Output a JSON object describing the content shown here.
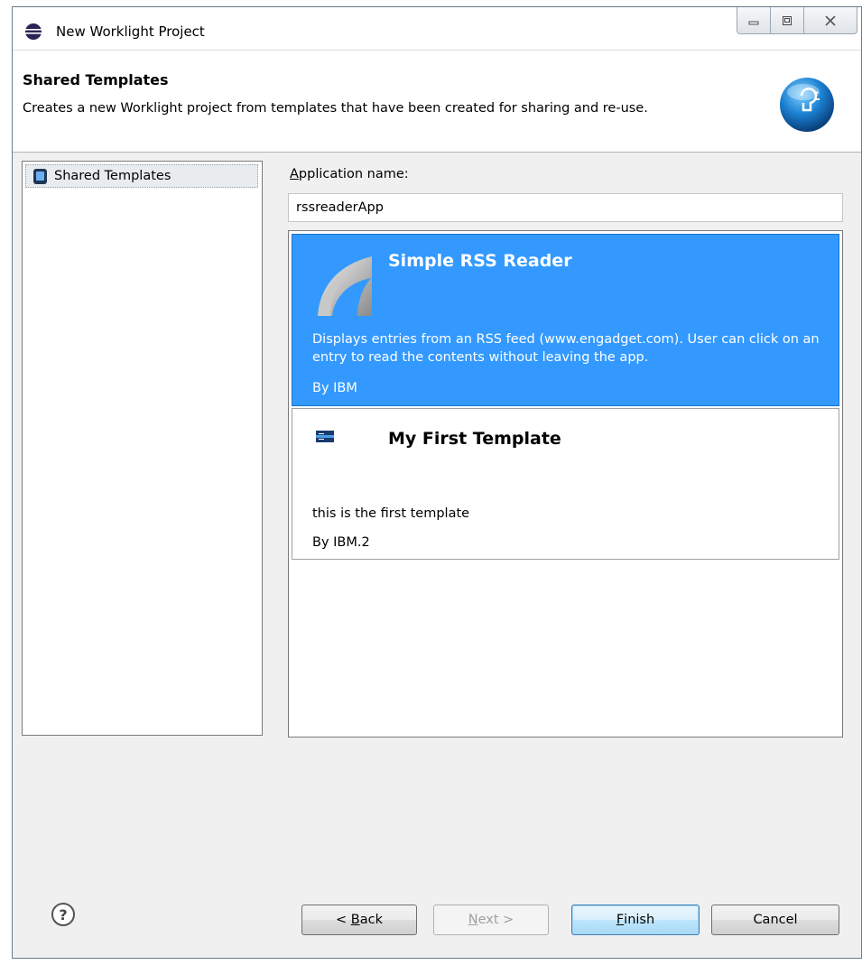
{
  "window": {
    "title": "New Worklight Project",
    "controls": [
      "minimize",
      "restore",
      "close"
    ]
  },
  "header": {
    "title": "Shared Templates",
    "description": "Creates a new Worklight project from templates that have been created for sharing and re-use."
  },
  "tree": {
    "items": [
      {
        "label": "Shared Templates",
        "icon": "mobile-device-icon"
      }
    ]
  },
  "form": {
    "app_name_label_mnemonic": "A",
    "app_name_label_rest": "pplication name:",
    "app_name_value": "rssreaderApp"
  },
  "templates": [
    {
      "title": "Simple RSS Reader",
      "description": "Displays entries from an RSS feed (www.engadget.com).  User can click on an entry to read the contents without leaving the app.",
      "author": "By IBM",
      "icon": "rss-icon",
      "selected": true
    },
    {
      "title": "My First Template",
      "description": "this is the first template",
      "author": "By IBM.2",
      "icon": "ibm-logo-icon",
      "selected": false
    }
  ],
  "buttons": {
    "back_prefix": "< ",
    "back_mnemonic": "B",
    "back_rest": "ack",
    "next_mnemonic": "N",
    "next_rest": "ext >",
    "finish_mnemonic": "F",
    "finish_rest": "inish",
    "cancel": "Cancel",
    "help_glyph": "?"
  },
  "colors": {
    "selection": "#3399ff",
    "window_bg": "#f0f0f0"
  }
}
